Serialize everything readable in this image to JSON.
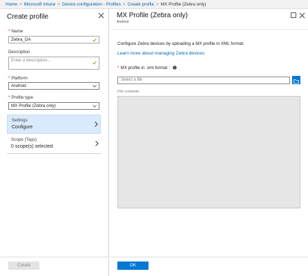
{
  "breadcrumb": {
    "items": [
      "Home",
      "Microsoft Intune",
      "Device configuration - Profiles",
      "Create profile",
      "MX Profile (Zebra only)"
    ],
    "separator": ">"
  },
  "left_blade": {
    "title": "Create profile",
    "name": {
      "label": "Name",
      "value": "Zebra_DA"
    },
    "description": {
      "label": "Description",
      "placeholder": "Enter a description..."
    },
    "platform": {
      "label": "Platform",
      "value": "Android"
    },
    "profile_type": {
      "label": "Profile type",
      "value": "MX Profile (Zebra only)"
    },
    "settings": {
      "title": "Settings",
      "subtitle": "Configure"
    },
    "scope": {
      "title": "Scope (Tags)",
      "subtitle": "0 scope(s) selected"
    },
    "create_label": "Create"
  },
  "right_blade": {
    "title": "MX Profile (Zebra only)",
    "subtitle": "Android",
    "description": "Configure Zebra devices by uploading a MX profile in XML format.",
    "learn_more": "Learn more about managing Zebra devices",
    "mx_label": "MX profile in .xml format :",
    "file_placeholder": "Select a file",
    "file_contents_label": "File contents",
    "ok_label": "OK"
  },
  "colors": {
    "accent": "#0078d4",
    "link": "#0063b1",
    "required": "#e81123",
    "selected_bg": "#d9eafc",
    "valid_check": "#57a300"
  }
}
